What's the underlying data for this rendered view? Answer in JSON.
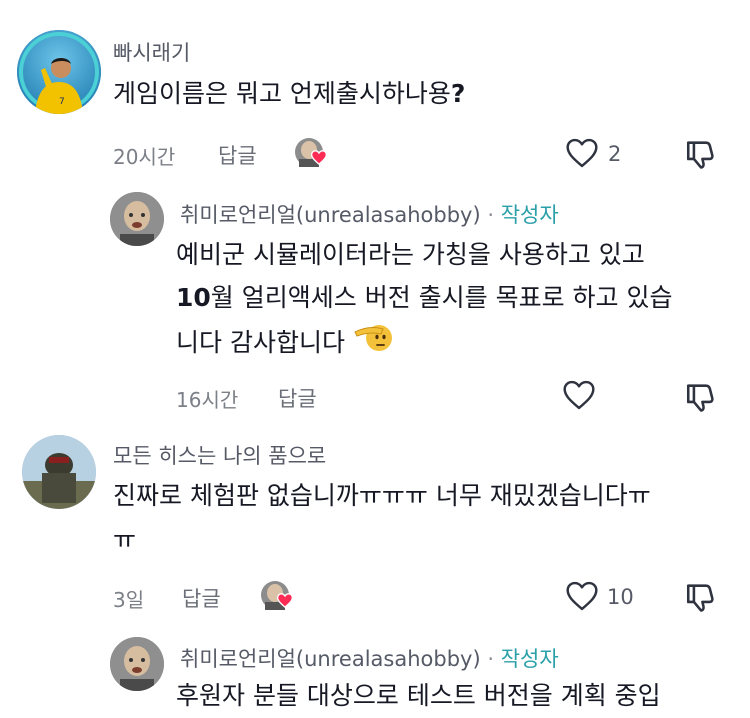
{
  "comments": [
    {
      "username": "빠시래기",
      "text": "게임이름은 뭐고 언제출시하나용",
      "text_punct": "?",
      "time": "20시간",
      "reply_label": "답글",
      "likes": "2",
      "reply": {
        "username": "취미로언리얼(unrealasahobby)",
        "separator": "·",
        "badge": "작성자",
        "lines": [
          "예비군 시뮬레이터라는 가칭을 사용하고 있고",
          "10월 얼리액세스 버전 출시를 목표로 하고 있습",
          "니다 감사합니다"
        ],
        "line2_bold_prefix": "10",
        "line2_rest": "월 얼리액세스 버전 출시를 목표로 하고 있습",
        "emoji": "🫡",
        "time": "16시간",
        "reply_label": "답글"
      }
    },
    {
      "username": "모든 히스는 나의 품으로",
      "lines": [
        "진짜로 체험판 없습니까ㅠㅠㅠ 너무 재밌겠습니다ㅠ",
        "ㅠ"
      ],
      "time": "3일",
      "reply_label": "답글",
      "likes": "10",
      "reply": {
        "username": "취미로언리얼(unrealasahobby)",
        "separator": "·",
        "badge": "작성자",
        "lines": [
          "후원자 분들 대상으로 테스트 버전을 계획 중입"
        ]
      }
    }
  ],
  "icons": {
    "like": "heart-outline-icon",
    "dislike": "thumbs-down-icon",
    "creator_liked": "heart-filled-icon"
  },
  "colors": {
    "accent": "#2ba0a8",
    "heart": "#fe2c55"
  }
}
